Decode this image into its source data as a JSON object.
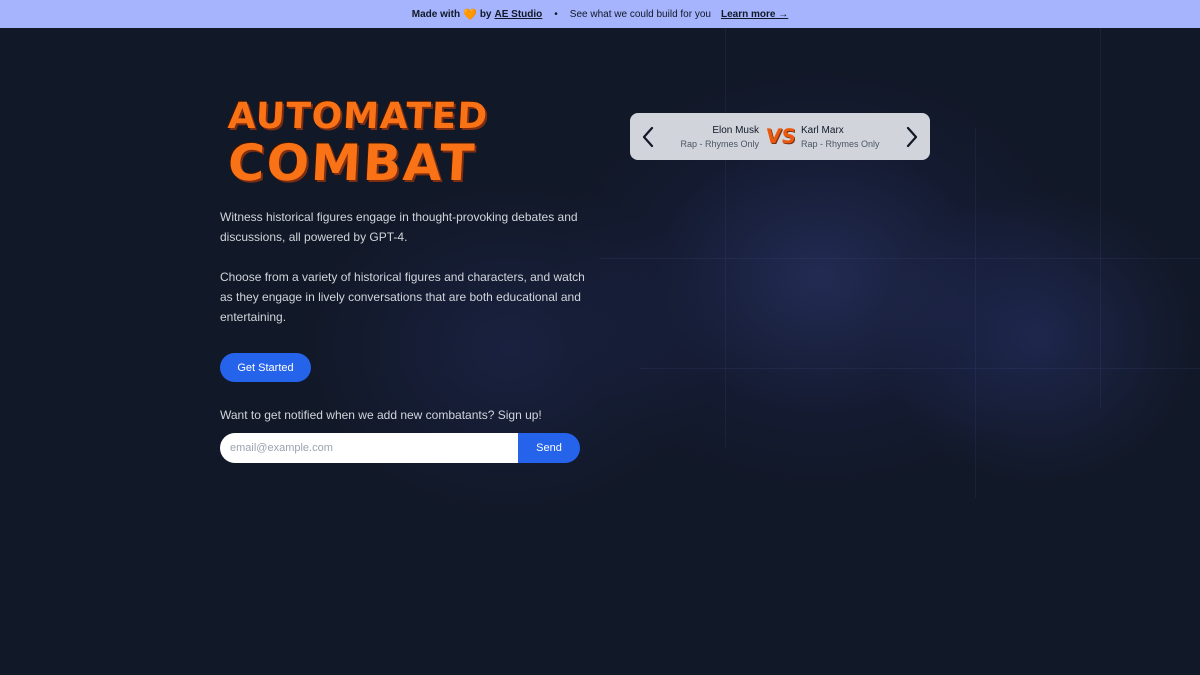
{
  "banner": {
    "made_with": "Made with",
    "heart": "🧡",
    "by": "by",
    "studio": "AE Studio",
    "separator": "•",
    "tagline": "See what we could build for you",
    "learn_more": "Learn more →"
  },
  "logo": {
    "line1": "AUTOMATED",
    "line2": "COMBAT"
  },
  "hero": {
    "paragraph1": "Witness historical figures engage in thought-provoking debates and discussions, all powered by GPT-4.",
    "paragraph2": "Choose from a variety of historical figures and characters, and watch as they engage in lively conversations that are both educational and entertaining.",
    "cta_label": "Get Started"
  },
  "signup": {
    "prompt": "Want to get notified when we add new combatants? Sign up!",
    "email_value": "",
    "email_placeholder": "email@example.com",
    "send_label": "Send"
  },
  "matchup": {
    "left_name": "Elon Musk",
    "left_mode": "Rap - Rhymes Only",
    "vs": "VS",
    "right_name": "Karl Marx",
    "right_mode": "Rap - Rhymes Only",
    "prev_icon": "chevron-left-icon",
    "next_icon": "chevron-right-icon"
  },
  "colors": {
    "background": "#111827",
    "banner": "#a5b4fc",
    "accent": "#2563eb",
    "logo": "#f97316"
  }
}
